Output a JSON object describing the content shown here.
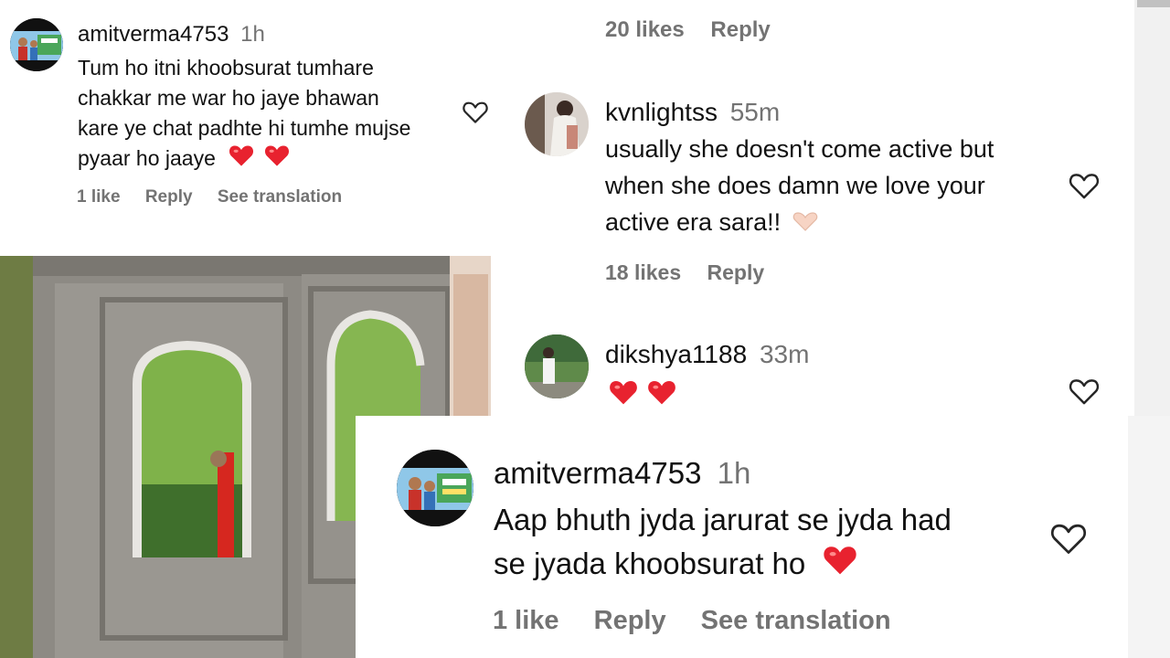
{
  "comments": [
    {
      "username": "amitverma4753",
      "time": "1h",
      "text_lines": [
        "Tum ho itni khoobsurat tumhare",
        "chakkar me war ho jaye bhawan",
        "kare ye chat padhte hi tumhe mujse",
        "pyaar ho jaaye"
      ],
      "emoji": "red-heart red-heart",
      "likes": "1 like",
      "reply": "Reply",
      "translate": "See translation"
    },
    {
      "likes": "20 likes",
      "reply": "Reply"
    },
    {
      "username": "kvnlightss",
      "time": "55m",
      "text_lines": [
        "usually she doesn't come active but",
        "when she does damn we love your",
        "active era sara!!"
      ],
      "emoji": "heart-hands",
      "likes": "18 likes",
      "reply": "Reply"
    },
    {
      "username": "dikshya1188",
      "time": "33m",
      "emoji": "red-heart red-heart"
    },
    {
      "username": "amitverma4753",
      "time": "1h",
      "text_lines": [
        "Aap bhuth jyda jarurat se jyda had",
        "se jyada khoobsurat ho"
      ],
      "emoji": "red-heart",
      "likes": "1 like",
      "reply": "Reply",
      "translate": "See translation"
    }
  ],
  "icons": {
    "like": "heart-outline-icon",
    "emoji_heart": "red-heart-emoji",
    "heart_hands": "heart-hands-emoji"
  },
  "colors": {
    "text": "#111111",
    "muted": "#737373",
    "red": "#e8222f"
  }
}
